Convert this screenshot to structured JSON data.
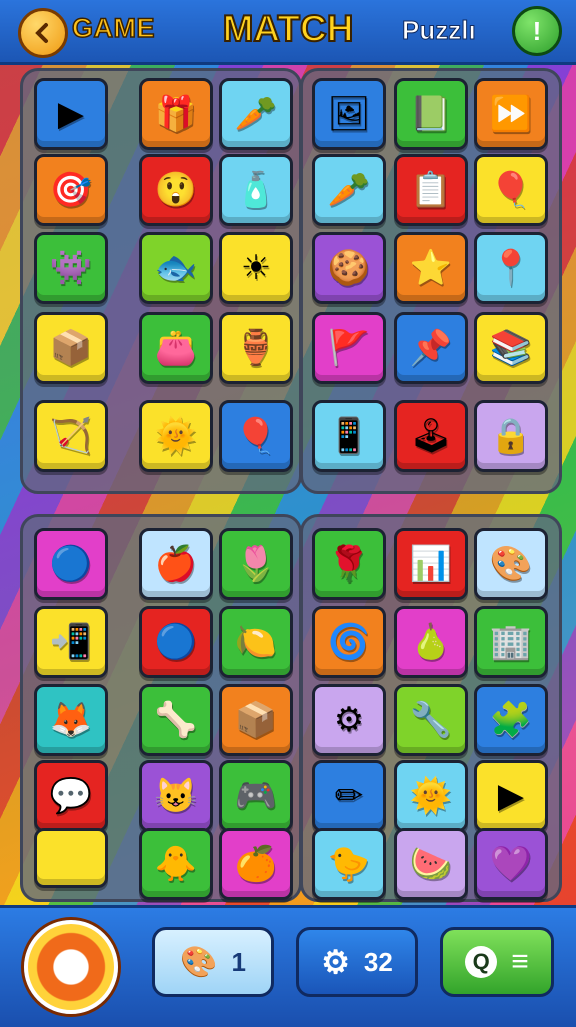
{
  "header": {
    "game_label": "GAME",
    "title": "MATCH",
    "puzzle_label": "Puzzlı",
    "info_icon": "!"
  },
  "colors": {
    "red": "#e52421",
    "orange": "#f2811e",
    "yellow": "#fbe12a",
    "green": "#3cbf3a",
    "lime": "#7fd32a",
    "blue": "#2d7fe0",
    "sky": "#6fd4f2",
    "purple": "#9b52d6",
    "magenta": "#e23fc9",
    "lilac": "#c9a6ee",
    "paleblue": "#bfe4ff"
  },
  "tiles": [
    {
      "icon": "play-store-icon",
      "glyph": "▶",
      "color": "#2d7fe0"
    },
    {
      "icon": "gift-box-icon",
      "glyph": "🎁",
      "color": "#f2811e"
    },
    {
      "icon": "carrot-icon",
      "glyph": "🥕",
      "color": "#6fd4f2"
    },
    {
      "icon": "photo-frame-icon",
      "glyph": "🖼",
      "color": "#2d7fe0"
    },
    {
      "icon": "book-icon",
      "glyph": "📗",
      "color": "#3cbf3a"
    },
    {
      "icon": "play-arrow-icon",
      "glyph": "⏩",
      "color": "#f2811e"
    },
    {
      "icon": "dart-arrow-icon",
      "glyph": "🎯",
      "color": "#f2811e"
    },
    {
      "icon": "red-face-icon",
      "glyph": "😲",
      "color": "#e52421"
    },
    {
      "icon": "bottle-icon",
      "glyph": "🧴",
      "color": "#6fd4f2"
    },
    {
      "icon": "carrot-leaf-icon",
      "glyph": "🥕",
      "color": "#6fd4f2"
    },
    {
      "icon": "checklist-icon",
      "glyph": "📋",
      "color": "#e52421"
    },
    {
      "icon": "balloon-dog-icon",
      "glyph": "🎈",
      "color": "#fbe12a"
    },
    {
      "icon": "monster-face-icon",
      "glyph": "👾",
      "color": "#3cbf3a"
    },
    {
      "icon": "fish-icon",
      "glyph": "🐟",
      "color": "#7fd32a"
    },
    {
      "icon": "sun-icon",
      "glyph": "☀",
      "color": "#fbe12a"
    },
    {
      "icon": "cookie-face-icon",
      "glyph": "🍪",
      "color": "#9b52d6"
    },
    {
      "icon": "star-wand-icon",
      "glyph": "⭐",
      "color": "#f2811e"
    },
    {
      "icon": "pin-icon",
      "glyph": "📍",
      "color": "#6fd4f2"
    },
    {
      "icon": "cube-box-icon",
      "glyph": "📦",
      "color": "#fbe12a"
    },
    {
      "icon": "bag-icon",
      "glyph": "👛",
      "color": "#3cbf3a"
    },
    {
      "icon": "jar-icon",
      "glyph": "🏺",
      "color": "#fbe12a"
    },
    {
      "icon": "flag-icon",
      "glyph": "🚩",
      "color": "#e23fc9"
    },
    {
      "icon": "map-pin-icon",
      "glyph": "📌",
      "color": "#2d7fe0"
    },
    {
      "icon": "books-icon",
      "glyph": "📚",
      "color": "#fbe12a"
    },
    {
      "icon": "arrow-icon",
      "glyph": "🏹",
      "color": "#fbe12a"
    },
    {
      "icon": "smiling-sun-icon",
      "glyph": "🌞",
      "color": "#fbe12a"
    },
    {
      "icon": "balloon-icon",
      "glyph": "🎈",
      "color": "#2d7fe0"
    },
    {
      "icon": "tablet-icon",
      "glyph": "📱",
      "color": "#6fd4f2"
    },
    {
      "icon": "arcade-icon",
      "glyph": "🕹",
      "color": "#e52421"
    },
    {
      "icon": "lock-bag-icon",
      "glyph": "🔒",
      "color": "#c9a6ee"
    },
    {
      "icon": "gear-ball-icon",
      "glyph": "🔵",
      "color": "#e23fc9"
    },
    {
      "icon": "apple-icon",
      "glyph": "🍎",
      "color": "#bfe4ff"
    },
    {
      "icon": "flower-icon",
      "glyph": "🌷",
      "color": "#3cbf3a"
    },
    {
      "icon": "rose-icon",
      "glyph": "🌹",
      "color": "#3cbf3a"
    },
    {
      "icon": "chart-icon",
      "glyph": "📊",
      "color": "#e52421"
    },
    {
      "icon": "painting-icon",
      "glyph": "🎨",
      "color": "#bfe4ff"
    },
    {
      "icon": "phone-icon",
      "glyph": "📲",
      "color": "#fbe12a"
    },
    {
      "icon": "blue-orb-icon",
      "glyph": "🔵",
      "color": "#e52421"
    },
    {
      "icon": "lemon-icon",
      "glyph": "🍋",
      "color": "#3cbf3a"
    },
    {
      "icon": "spiral-icon",
      "glyph": "🌀",
      "color": "#f2811e"
    },
    {
      "icon": "pear-icon",
      "glyph": "🍐",
      "color": "#e23fc9"
    },
    {
      "icon": "building-icon",
      "glyph": "🏢",
      "color": "#3cbf3a"
    },
    {
      "icon": "fox-icon",
      "glyph": "🦊",
      "color": "#2fc3c3"
    },
    {
      "icon": "bone-icon",
      "glyph": "🦴",
      "color": "#3cbf3a"
    },
    {
      "icon": "sticker-box-icon",
      "glyph": "📦",
      "color": "#f2811e"
    },
    {
      "icon": "gear-face-icon",
      "glyph": "⚙",
      "color": "#c9a6ee"
    },
    {
      "icon": "tool-icon",
      "glyph": "🔧",
      "color": "#7fd32a"
    },
    {
      "icon": "puzzle-card-icon",
      "glyph": "🧩",
      "color": "#2d7fe0"
    },
    {
      "icon": "heart-bubble-icon",
      "glyph": "💬",
      "color": "#e52421"
    },
    {
      "icon": "purple-face-icon",
      "glyph": "😺",
      "color": "#9b52d6"
    },
    {
      "icon": "gameboy-icon",
      "glyph": "🎮",
      "color": "#3cbf3a"
    },
    {
      "icon": "pencil-icon",
      "glyph": "✏",
      "color": "#2d7fe0"
    },
    {
      "icon": "sun-face-icon",
      "glyph": "🌞",
      "color": "#6fd4f2"
    },
    {
      "icon": "play-red-icon",
      "glyph": "▶",
      "color": "#fbe12a"
    },
    {
      "icon": "yellow-tile-icon",
      "glyph": "",
      "color": "#fbe12a"
    },
    {
      "icon": "chick-icon",
      "glyph": "🐥",
      "color": "#3cbf3a"
    },
    {
      "icon": "orange-blob-icon",
      "glyph": "🍊",
      "color": "#e23fc9"
    },
    {
      "icon": "duck-icon",
      "glyph": "🐤",
      "color": "#6fd4f2"
    },
    {
      "icon": "melon-icon",
      "glyph": "🍉",
      "color": "#c9a6ee"
    },
    {
      "icon": "heart-icon",
      "glyph": "💜",
      "color": "#9b52d6"
    }
  ],
  "footer": {
    "hint_count": "1",
    "settings_count": "32",
    "menu_icon": "Q"
  }
}
